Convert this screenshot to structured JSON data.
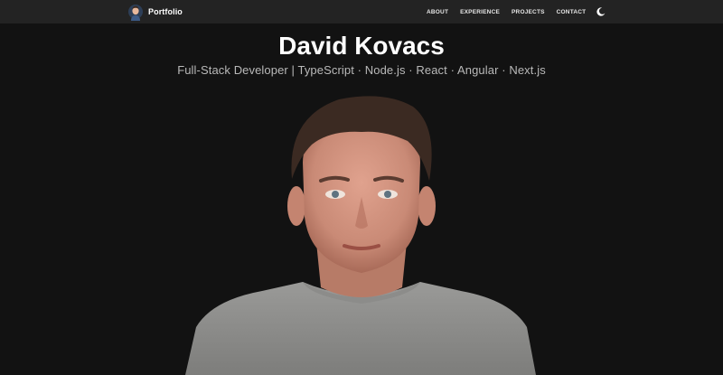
{
  "nav": {
    "brand_label": "Portfolio",
    "links": [
      {
        "label": "ABOUT"
      },
      {
        "label": "EXPERIENCE"
      },
      {
        "label": "PROJECTS"
      },
      {
        "label": "CONTACT"
      }
    ],
    "theme_toggle_icon": "moon-icon"
  },
  "hero": {
    "name": "David Kovacs",
    "subtitle": "Full-Stack Developer | TypeScript · Node.js · React · Angular · Next.js"
  },
  "colors": {
    "page_background": "#121212",
    "navbar_background": "#232323",
    "title_text": "#ffffff",
    "subtitle_text": "#b9b9b9"
  }
}
